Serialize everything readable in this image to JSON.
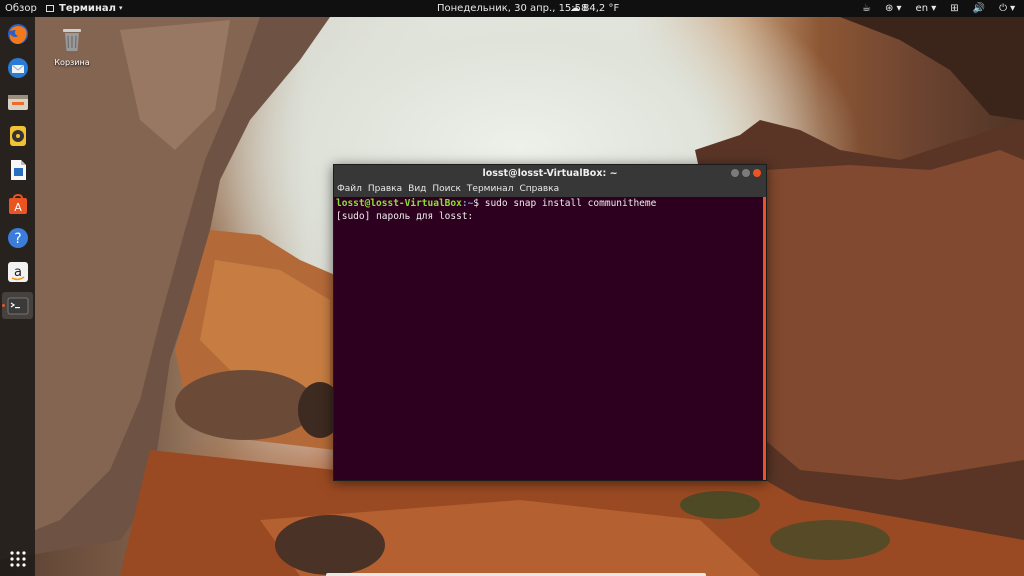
{
  "topbar": {
    "activities": "Обзор",
    "app_menu": "Терминал",
    "clock": "Понедельник, 30 апр., 15:58",
    "temperature": "84,2 °F",
    "language": "en"
  },
  "desktop": {
    "trash_label": "Корзина"
  },
  "dock": {
    "items": [
      "firefox-icon",
      "thunderbird-icon",
      "files-icon",
      "rhythmbox-icon",
      "libreoffice-writer-icon",
      "software-center-icon",
      "help-icon",
      "amazon-icon",
      "terminal-icon",
      "show-apps-icon"
    ]
  },
  "terminal": {
    "title": "losst@losst-VirtualBox: ~",
    "menu": [
      "Файл",
      "Правка",
      "Вид",
      "Поиск",
      "Терминал",
      "Справка"
    ],
    "prompt_user": "losst@losst-VirtualBox",
    "prompt_path": ":~",
    "command": "$ sudo snap install communitheme",
    "output": "[sudo] пароль для losst:"
  },
  "colors": {
    "accent": "#e95420",
    "terminal_bg": "#2c001e",
    "prompt_user": "#8ae234",
    "prompt_path": "#729fcf"
  }
}
